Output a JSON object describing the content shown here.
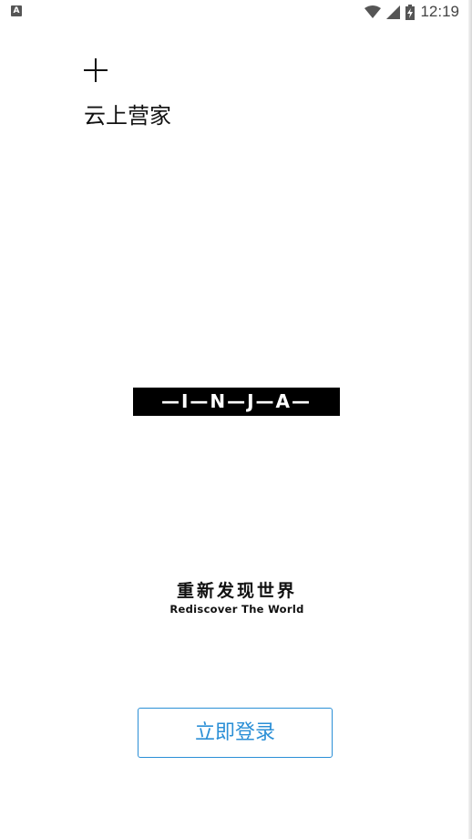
{
  "status_bar": {
    "app_badge": "A",
    "time": "12:19",
    "icons": [
      "wifi-icon",
      "signal-icon",
      "battery-charging-icon"
    ]
  },
  "logo": {
    "mark": "plus-icon",
    "name": "云上营家"
  },
  "brand": {
    "text": "—I—N—J—A—"
  },
  "slogan": {
    "cn": "重新发现世界",
    "en": "Rediscover The World"
  },
  "login_button": {
    "label": "立即登录",
    "color": "#2b8fd6"
  }
}
